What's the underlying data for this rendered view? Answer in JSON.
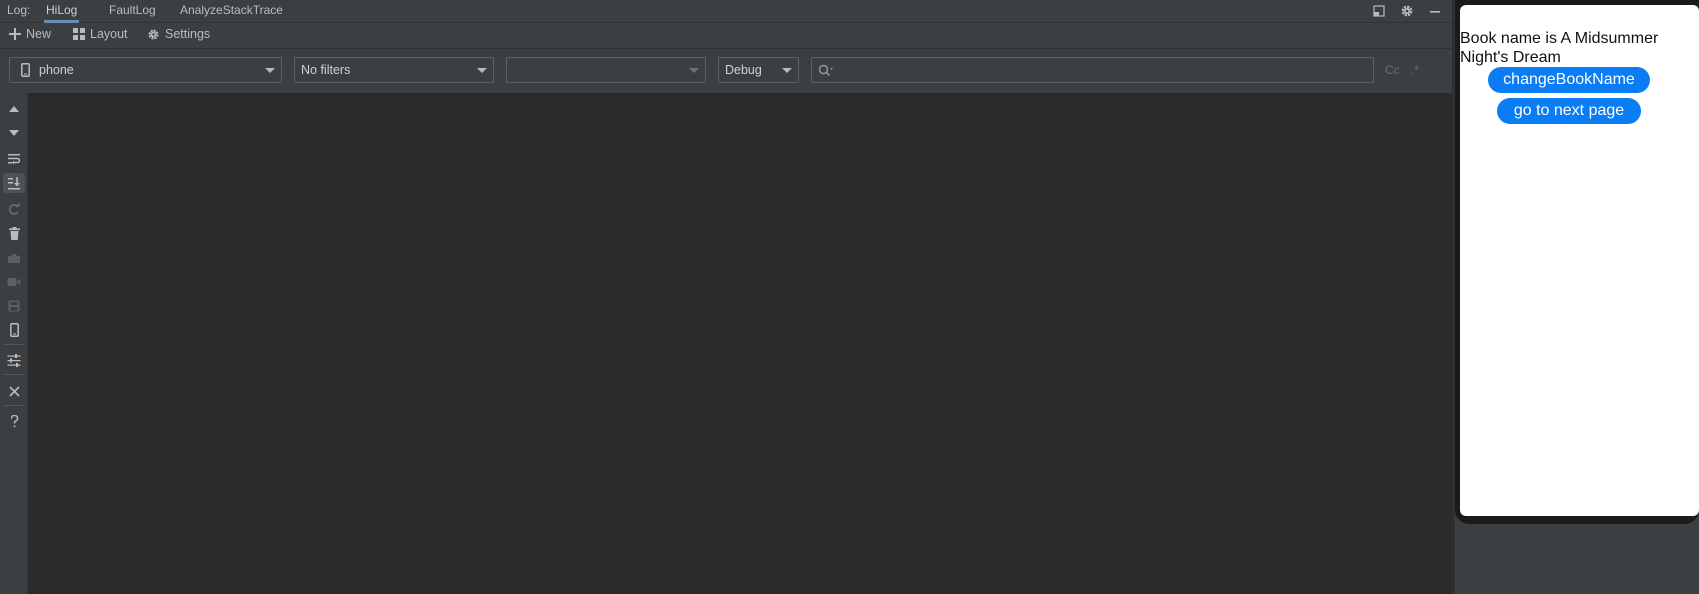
{
  "tabs": {
    "prefix": "Log:",
    "items": [
      {
        "label": "HiLog",
        "active": true
      },
      {
        "label": "FaultLog",
        "active": false
      },
      {
        "label": "AnalyzeStackTrace",
        "active": false
      }
    ]
  },
  "toolbar": {
    "new_label": "New",
    "layout_label": "Layout",
    "settings_label": "Settings"
  },
  "filters": {
    "device": "phone",
    "filter": "No filters",
    "process": "",
    "level": "Debug",
    "search_placeholder": "",
    "match_case_label": "Cc",
    "regex_label": ".*"
  },
  "preview": {
    "book_text": "Book name is  A Midsummer Night's Dream",
    "change_button": "changeBookName",
    "next_button": "go to next page"
  },
  "colors": {
    "accent_button": "#0a7cf4",
    "log_background": "#2b2b2b",
    "panel_background": "#3c3f41"
  }
}
